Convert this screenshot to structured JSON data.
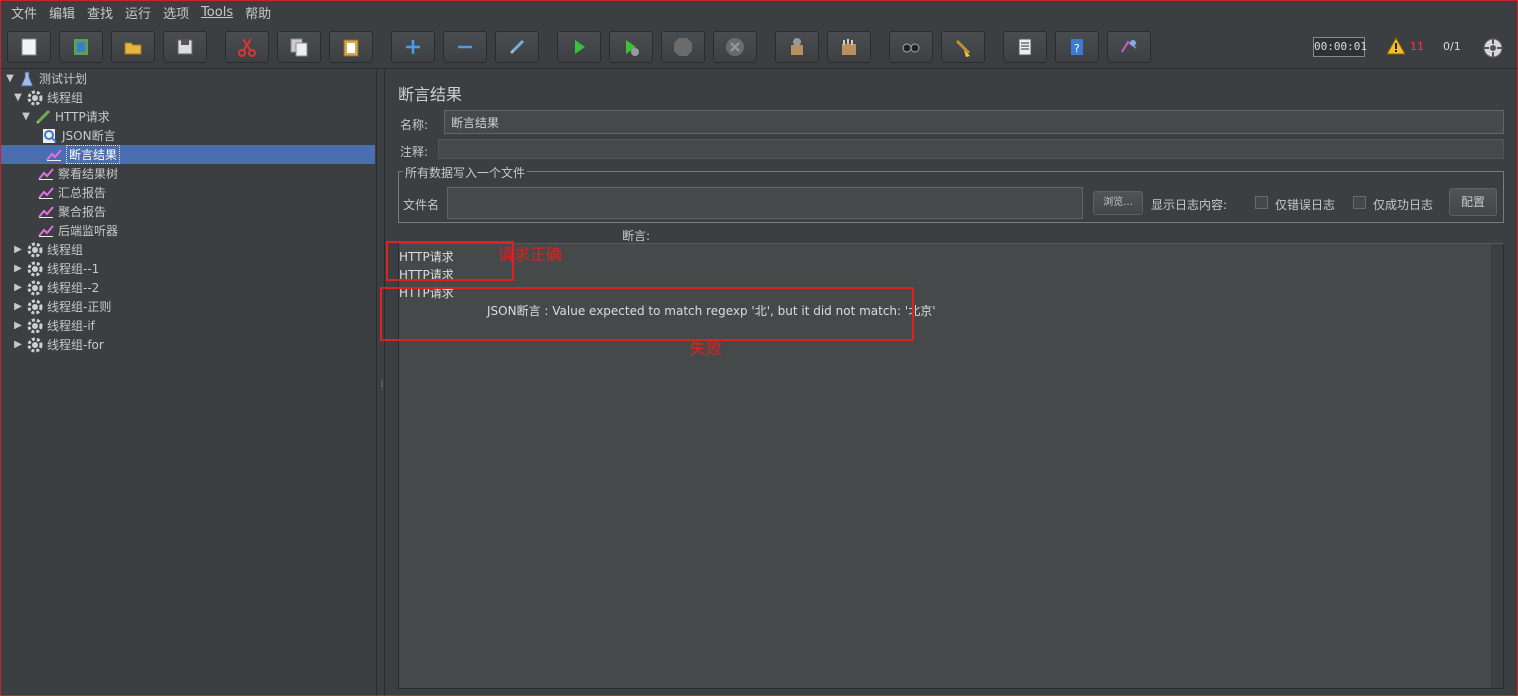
{
  "menu": [
    "文件",
    "编辑",
    "查找",
    "运行",
    "选项",
    "Tools",
    "帮助"
  ],
  "toolbar": {
    "buttons": [
      "new-icon",
      "templates-icon",
      "open-icon",
      "save-icon",
      "cut-icon",
      "copy-icon",
      "paste-icon",
      "expand-icon",
      "collapse-icon",
      "toggle-icon",
      "start-icon",
      "start-no-pause-icon",
      "stop-icon",
      "shutdown-icon",
      "clear-icon",
      "clear-all-icon",
      "search-icon",
      "reset-search-icon",
      "function-helper-icon",
      "help-icon",
      "remote-icon"
    ],
    "timer": "00:00:01",
    "warning_count": "11",
    "threads": "0/1"
  },
  "tree": {
    "items": [
      {
        "label": "测试计划",
        "icon": "test-plan-icon"
      },
      {
        "label": "线程组",
        "icon": "gear-icon"
      },
      {
        "label": "HTTP请求",
        "icon": "http-sampler-icon"
      },
      {
        "label": "JSON断言",
        "icon": "assertion-icon"
      },
      {
        "label": "断言结果",
        "icon": "listener-icon"
      },
      {
        "label": "察看结果树",
        "icon": "listener-icon"
      },
      {
        "label": "汇总报告",
        "icon": "listener-icon"
      },
      {
        "label": "聚合报告",
        "icon": "listener-icon"
      },
      {
        "label": "后端监听器",
        "icon": "listener-icon"
      },
      {
        "label": "线程组",
        "icon": "gear-icon"
      },
      {
        "label": "线程组--1",
        "icon": "gear-icon"
      },
      {
        "label": "线程组--2",
        "icon": "gear-icon"
      },
      {
        "label": "线程组-正则",
        "icon": "gear-icon"
      },
      {
        "label": "线程组-if",
        "icon": "gear-icon"
      },
      {
        "label": "线程组-for",
        "icon": "gear-icon"
      }
    ]
  },
  "panel": {
    "title": "断言结果",
    "name_label": "名称:",
    "name_value": "断言结果",
    "comment_label": "注释:",
    "comment_value": "",
    "file_group_legend": "所有数据写入一个文件",
    "filename_label": "文件名",
    "filename_value": "",
    "browse_label": "浏览...",
    "log_display_label": "显示日志内容:",
    "errors_only_label": "仅错误日志",
    "success_only_label": "仅成功日志",
    "configure_label": "配置",
    "assertions_header": "断言:"
  },
  "results": {
    "lines": [
      "HTTP请求",
      "HTTP请求",
      "HTTP请求"
    ],
    "failure_message": "JSON断言 : Value expected to match regexp '北', but it did not match: '北京'"
  },
  "annotations": {
    "success_note": "请求正确",
    "failure_note": "失败",
    "color": "#e02020"
  }
}
